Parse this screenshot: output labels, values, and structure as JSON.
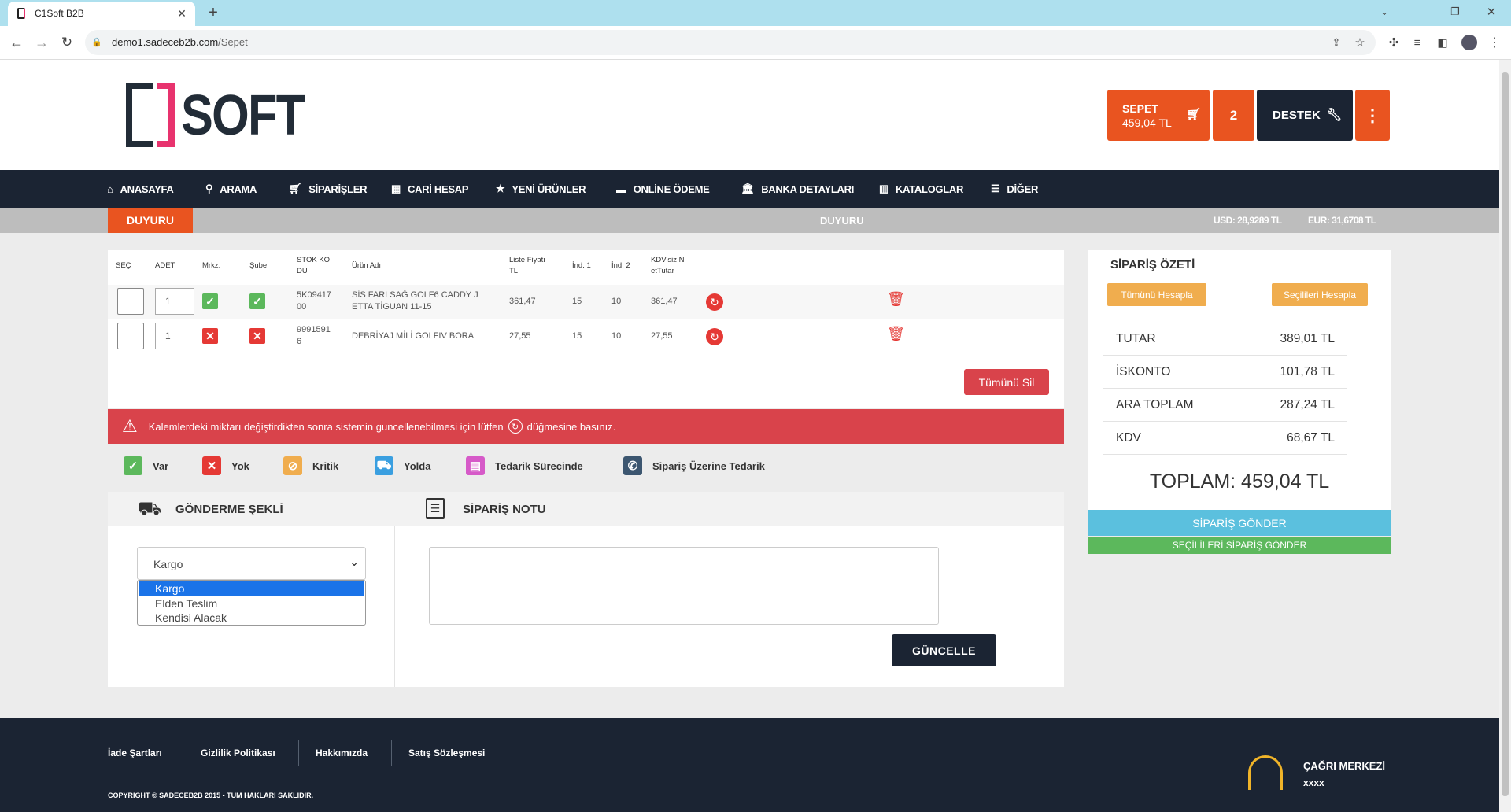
{
  "browser": {
    "tab_title": "C1Soft B2B",
    "url_host": "demo1.sadeceb2b.com",
    "url_path": "/Sepet"
  },
  "header": {
    "logo_text": "SOFT",
    "cart_label": "SEPET",
    "cart_total": "459,04 TL",
    "cart_count": "2",
    "support_label": "DESTEK"
  },
  "nav": {
    "items": [
      {
        "label": "ANASAYFA",
        "icon": "home-icon"
      },
      {
        "label": "ARAMA",
        "icon": "search-icon"
      },
      {
        "label": "SİPARİŞLER",
        "icon": "cart-icon"
      },
      {
        "label": "CARİ HESAP",
        "icon": "calculator-icon"
      },
      {
        "label": "YENİ ÜRÜNLER",
        "icon": "star-icon"
      },
      {
        "label": "ONLİNE ÖDEME",
        "icon": "credit-card-icon"
      },
      {
        "label": "BANKA DETAYLARI",
        "icon": "bank-icon"
      },
      {
        "label": "KATALOGLAR",
        "icon": "map-icon"
      },
      {
        "label": "DİĞER",
        "icon": "list-icon"
      }
    ]
  },
  "announcement": {
    "badge": "DUYURU",
    "text": "DUYURU",
    "usd": "USD: 28,9289 TL",
    "eur": "EUR: 31,6708 TL"
  },
  "cart_table": {
    "headers": {
      "sec": "SEÇ",
      "adet": "ADET",
      "mrkz": "Mrkz.",
      "sube": "Şube",
      "stok_1": "STOK KO",
      "stok_2": "DU",
      "urun": "Ürün Adı",
      "liste_1": "Liste Fiyatı",
      "liste_2": "TL",
      "ind1": "İnd. 1",
      "ind2": "İnd. 2",
      "kdv_1": "KDV'siz N",
      "kdv_2": "etTutar"
    },
    "rows": [
      {
        "qty": "1",
        "mrkz": "var",
        "sube": "var",
        "code_1": "5K09417",
        "code_2": "00",
        "name_1": "SİS FARI SAĞ GOLF6 CADDY J",
        "name_2": "ETTA TİGUAN 11-15",
        "price": "361,47",
        "ind1": "15",
        "ind2": "10",
        "net": "361,47"
      },
      {
        "qty": "1",
        "mrkz": "yok",
        "sube": "yok",
        "code_1": "9991591",
        "code_2": "6",
        "name_1": "DEBRİYAJ MİLİ GOLFIV BORA",
        "name_2": "",
        "price": "27,55",
        "ind1": "15",
        "ind2": "10",
        "net": "27,55"
      }
    ],
    "delete_all": "Tümünü Sil"
  },
  "alert": {
    "text_before": "Kalemlerdeki miktarı değiştirdikten sonra sistemin guncellenebilmesi için lütfen",
    "text_after": "düğmesine basınız."
  },
  "legend": [
    {
      "label": "Var",
      "color": "#5cb85c"
    },
    {
      "label": "Yok",
      "color": "#e53935"
    },
    {
      "label": "Kritik",
      "color": "#f0ad4e"
    },
    {
      "label": "Yolda",
      "color": "#3a9fe0"
    },
    {
      "label": "Tedarik Sürecinde",
      "color": "#d65ac8"
    },
    {
      "label": "Sipariş Üzerine Tedarik",
      "color": "#3c5670"
    }
  ],
  "shipping": {
    "title": "GÖNDERME ŞEKLİ",
    "selected": "Kargo",
    "options": [
      "Kargo",
      "Elden Teslim",
      "Kendisi Alacak"
    ]
  },
  "order_note": {
    "title": "SİPARİŞ NOTU",
    "update_button": "GÜNCELLE"
  },
  "summary": {
    "title": "SİPARİŞ ÖZETİ",
    "calc_all": "Tümünü Hesapla",
    "calc_selected": "Seçilileri Hesapla",
    "rows": [
      {
        "label": "TUTAR",
        "value": "389,01 TL"
      },
      {
        "label": "İSKONTO",
        "value": "101,78 TL"
      },
      {
        "label": "ARA TOPLAM",
        "value": "287,24 TL"
      },
      {
        "label": "KDV",
        "value": "68,67 TL"
      }
    ],
    "total": "TOPLAM: 459,04 TL",
    "send_order": "SİPARİŞ GÖNDER",
    "send_selected": "SEÇİLİLERİ SİPARİŞ GÖNDER"
  },
  "footer": {
    "links": [
      "İade Şartları",
      "Gizlilik Politikası",
      "Hakkımızda",
      "Satış Sözleşmesi"
    ],
    "copyright": "COPYRIGHT © SADECEB2B 2015 - TÜM HAKLARI SAKLIDIR.",
    "call_center_label": "ÇAĞRI MERKEZİ",
    "call_center_number": "xxxx"
  }
}
